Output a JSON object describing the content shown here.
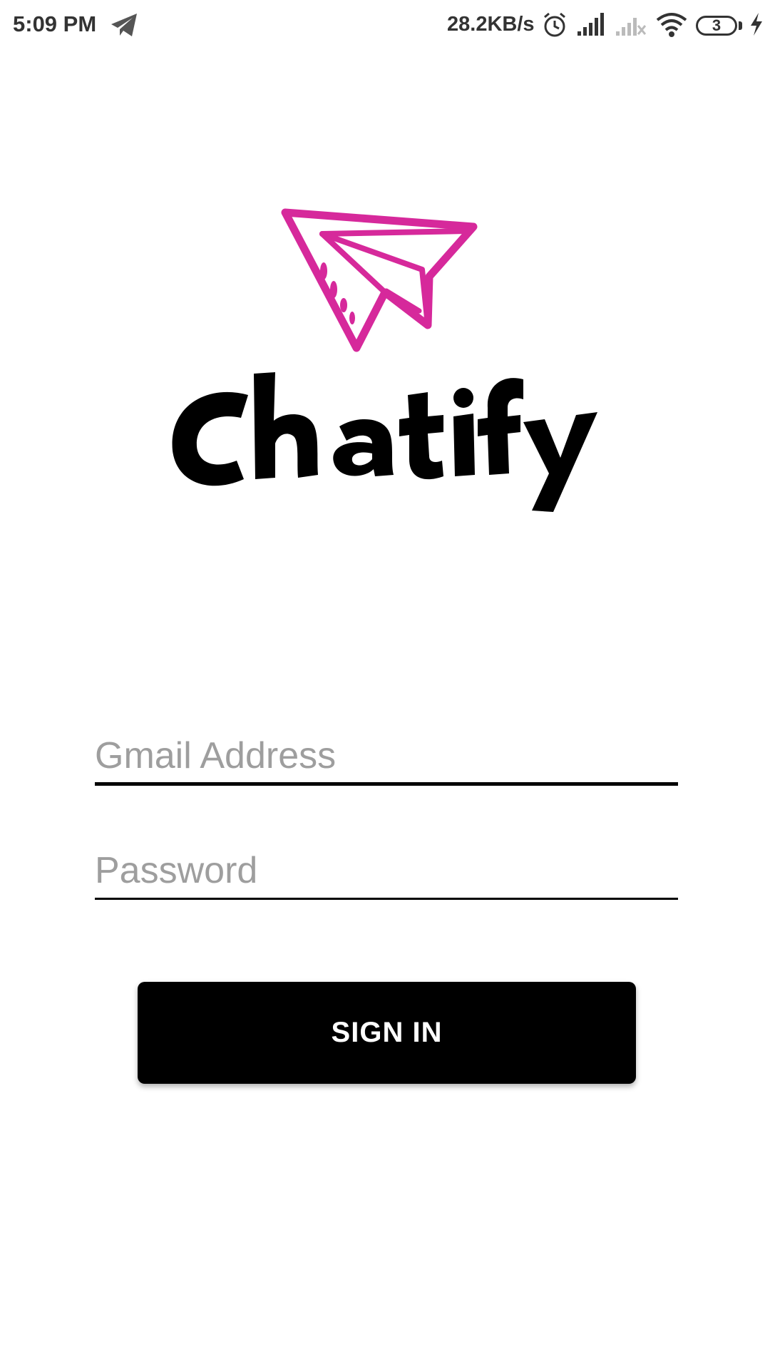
{
  "status_bar": {
    "time": "5:09 PM",
    "net_speed": "28.2KB/s",
    "battery_level": "3",
    "icons": [
      "telegram-icon",
      "alarm-icon",
      "signal-icon",
      "signal-no-service-icon",
      "wifi-icon",
      "battery-icon",
      "charging-icon"
    ]
  },
  "logo": {
    "name": "Chatify",
    "plane_color": "#d6299b",
    "text_color": "#000000"
  },
  "form": {
    "email_placeholder": "Gmail Address",
    "email_value": "",
    "password_placeholder": "Password",
    "password_value": "",
    "sign_in_label": "SIGN IN"
  },
  "colors": {
    "background": "#ffffff",
    "button": "#000000",
    "button_text": "#ffffff",
    "placeholder": "#9e9e9e"
  }
}
